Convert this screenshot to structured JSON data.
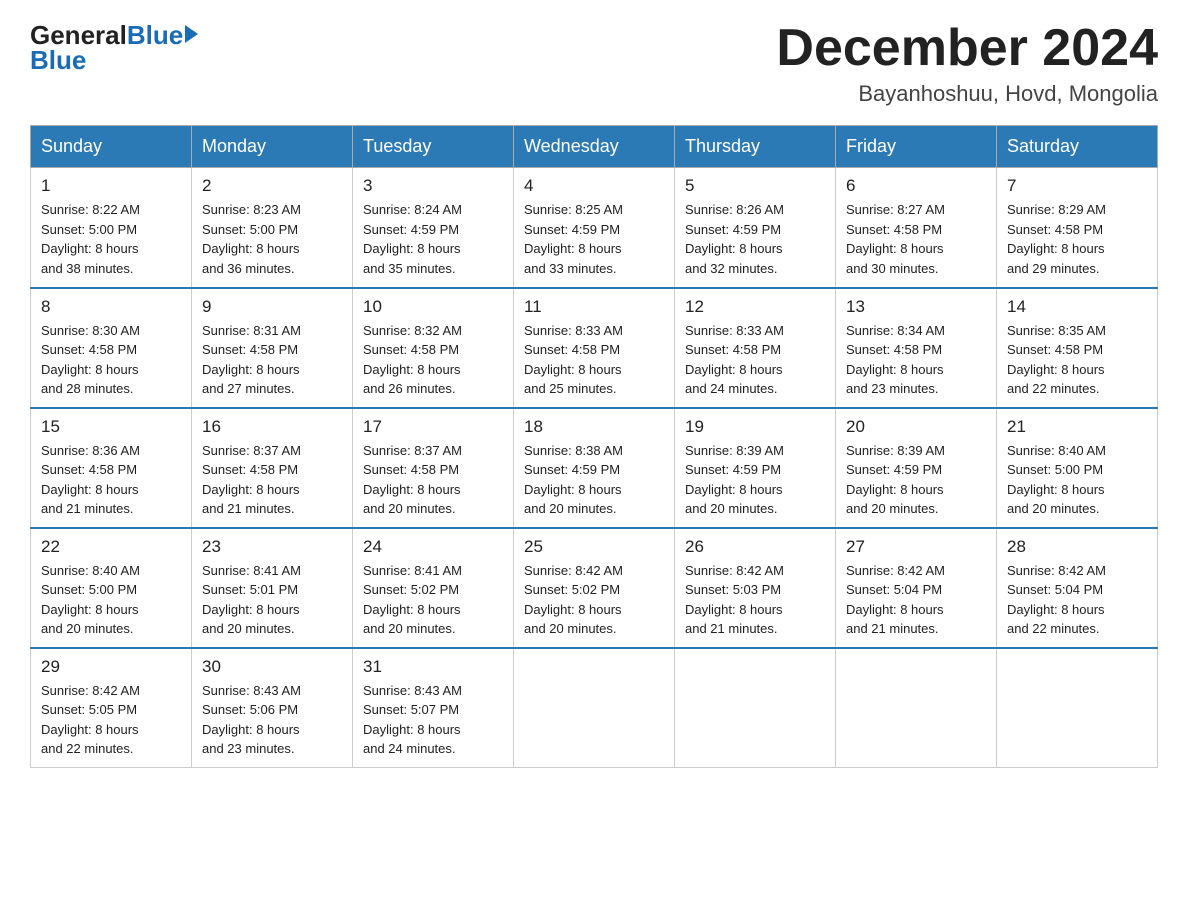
{
  "header": {
    "logo_general": "General",
    "logo_blue": "Blue",
    "month_title": "December 2024",
    "location": "Bayanhoshuu, Hovd, Mongolia"
  },
  "weekdays": [
    "Sunday",
    "Monday",
    "Tuesday",
    "Wednesday",
    "Thursday",
    "Friday",
    "Saturday"
  ],
  "weeks": [
    [
      {
        "day": 1,
        "sunrise": "8:22 AM",
        "sunset": "5:00 PM",
        "daylight": "8 hours and 38 minutes."
      },
      {
        "day": 2,
        "sunrise": "8:23 AM",
        "sunset": "5:00 PM",
        "daylight": "8 hours and 36 minutes."
      },
      {
        "day": 3,
        "sunrise": "8:24 AM",
        "sunset": "4:59 PM",
        "daylight": "8 hours and 35 minutes."
      },
      {
        "day": 4,
        "sunrise": "8:25 AM",
        "sunset": "4:59 PM",
        "daylight": "8 hours and 33 minutes."
      },
      {
        "day": 5,
        "sunrise": "8:26 AM",
        "sunset": "4:59 PM",
        "daylight": "8 hours and 32 minutes."
      },
      {
        "day": 6,
        "sunrise": "8:27 AM",
        "sunset": "4:58 PM",
        "daylight": "8 hours and 30 minutes."
      },
      {
        "day": 7,
        "sunrise": "8:29 AM",
        "sunset": "4:58 PM",
        "daylight": "8 hours and 29 minutes."
      }
    ],
    [
      {
        "day": 8,
        "sunrise": "8:30 AM",
        "sunset": "4:58 PM",
        "daylight": "8 hours and 28 minutes."
      },
      {
        "day": 9,
        "sunrise": "8:31 AM",
        "sunset": "4:58 PM",
        "daylight": "8 hours and 27 minutes."
      },
      {
        "day": 10,
        "sunrise": "8:32 AM",
        "sunset": "4:58 PM",
        "daylight": "8 hours and 26 minutes."
      },
      {
        "day": 11,
        "sunrise": "8:33 AM",
        "sunset": "4:58 PM",
        "daylight": "8 hours and 25 minutes."
      },
      {
        "day": 12,
        "sunrise": "8:33 AM",
        "sunset": "4:58 PM",
        "daylight": "8 hours and 24 minutes."
      },
      {
        "day": 13,
        "sunrise": "8:34 AM",
        "sunset": "4:58 PM",
        "daylight": "8 hours and 23 minutes."
      },
      {
        "day": 14,
        "sunrise": "8:35 AM",
        "sunset": "4:58 PM",
        "daylight": "8 hours and 22 minutes."
      }
    ],
    [
      {
        "day": 15,
        "sunrise": "8:36 AM",
        "sunset": "4:58 PM",
        "daylight": "8 hours and 21 minutes."
      },
      {
        "day": 16,
        "sunrise": "8:37 AM",
        "sunset": "4:58 PM",
        "daylight": "8 hours and 21 minutes."
      },
      {
        "day": 17,
        "sunrise": "8:37 AM",
        "sunset": "4:58 PM",
        "daylight": "8 hours and 20 minutes."
      },
      {
        "day": 18,
        "sunrise": "8:38 AM",
        "sunset": "4:59 PM",
        "daylight": "8 hours and 20 minutes."
      },
      {
        "day": 19,
        "sunrise": "8:39 AM",
        "sunset": "4:59 PM",
        "daylight": "8 hours and 20 minutes."
      },
      {
        "day": 20,
        "sunrise": "8:39 AM",
        "sunset": "4:59 PM",
        "daylight": "8 hours and 20 minutes."
      },
      {
        "day": 21,
        "sunrise": "8:40 AM",
        "sunset": "5:00 PM",
        "daylight": "8 hours and 20 minutes."
      }
    ],
    [
      {
        "day": 22,
        "sunrise": "8:40 AM",
        "sunset": "5:00 PM",
        "daylight": "8 hours and 20 minutes."
      },
      {
        "day": 23,
        "sunrise": "8:41 AM",
        "sunset": "5:01 PM",
        "daylight": "8 hours and 20 minutes."
      },
      {
        "day": 24,
        "sunrise": "8:41 AM",
        "sunset": "5:02 PM",
        "daylight": "8 hours and 20 minutes."
      },
      {
        "day": 25,
        "sunrise": "8:42 AM",
        "sunset": "5:02 PM",
        "daylight": "8 hours and 20 minutes."
      },
      {
        "day": 26,
        "sunrise": "8:42 AM",
        "sunset": "5:03 PM",
        "daylight": "8 hours and 21 minutes."
      },
      {
        "day": 27,
        "sunrise": "8:42 AM",
        "sunset": "5:04 PM",
        "daylight": "8 hours and 21 minutes."
      },
      {
        "day": 28,
        "sunrise": "8:42 AM",
        "sunset": "5:04 PM",
        "daylight": "8 hours and 22 minutes."
      }
    ],
    [
      {
        "day": 29,
        "sunrise": "8:42 AM",
        "sunset": "5:05 PM",
        "daylight": "8 hours and 22 minutes."
      },
      {
        "day": 30,
        "sunrise": "8:43 AM",
        "sunset": "5:06 PM",
        "daylight": "8 hours and 23 minutes."
      },
      {
        "day": 31,
        "sunrise": "8:43 AM",
        "sunset": "5:07 PM",
        "daylight": "8 hours and 24 minutes."
      },
      null,
      null,
      null,
      null
    ]
  ]
}
